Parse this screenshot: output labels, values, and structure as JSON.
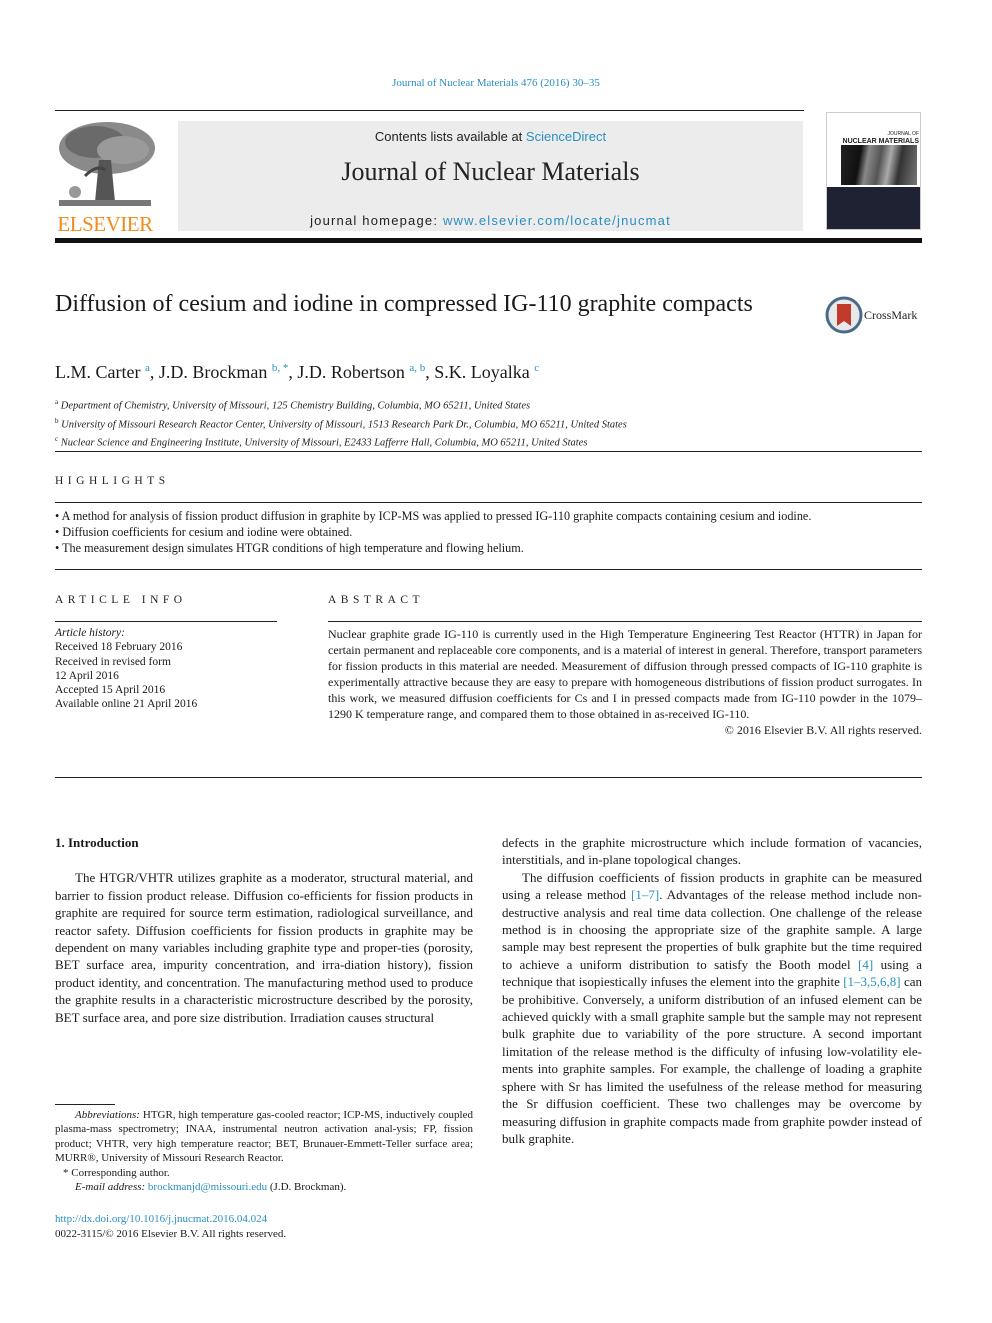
{
  "header": {
    "citation": "Journal of Nuclear Materials 476 (2016) 30–35",
    "contents_prefix": "Contents lists available at ",
    "contents_link": "ScienceDirect",
    "journal_title": "Journal of Nuclear Materials",
    "homepage_prefix": "journal homepage: ",
    "homepage_link": "www.elsevier.com/locate/jnucmat",
    "publisher_logo_text": "ELSEVIER",
    "cover_title_line1": "JOURNAL OF",
    "cover_title_line2": "NUCLEAR MATERIALS",
    "crossmark_label": "CrossMark"
  },
  "article": {
    "title": "Diffusion of cesium and iodine in compressed IG-110 graphite compacts",
    "authors": [
      {
        "name": "L.M. Carter",
        "sup": "a",
        "sep": ", "
      },
      {
        "name": "J.D. Brockman",
        "sup": "b, *",
        "sep": ", "
      },
      {
        "name": "J.D. Robertson",
        "sup": "a, b",
        "sep": ", "
      },
      {
        "name": "S.K. Loyalka",
        "sup": "c",
        "sep": ""
      }
    ],
    "affiliations": [
      {
        "key": "a",
        "text": "Department of Chemistry, University of Missouri, 125 Chemistry Building, Columbia, MO 65211, United States"
      },
      {
        "key": "b",
        "text": "University of Missouri Research Reactor Center, University of Missouri, 1513 Research Park Dr., Columbia, MO 65211, United States"
      },
      {
        "key": "c",
        "text": "Nuclear Science and Engineering Institute, University of Missouri, E2433 Lafferre Hall, Columbia, MO 65211, United States"
      }
    ]
  },
  "highlights": {
    "label": "HIGHLIGHTS",
    "items": [
      "A method for analysis of fission product diffusion in graphite by ICP-MS was applied to pressed IG-110 graphite compacts containing cesium and iodine.",
      "Diffusion coefficients for cesium and iodine were obtained.",
      "The measurement design simulates HTGR conditions of high temperature and flowing helium."
    ]
  },
  "article_info": {
    "label": "ARTICLE INFO",
    "history_label": "Article history:",
    "history": [
      "Received 18 February 2016",
      "Received in revised form",
      "12 April 2016",
      "Accepted 15 April 2016",
      "Available online 21 April 2016"
    ]
  },
  "abstract": {
    "label": "ABSTRACT",
    "text": "Nuclear graphite grade IG-110 is currently used in the High Temperature Engineering Test Reactor (HTTR) in Japan for certain permanent and replaceable core components, and is a material of interest in general. Therefore, transport parameters for fission products in this material are needed. Measurement of diffusion through pressed compacts of IG-110 graphite is experimentally attractive because they are easy to prepare with homogeneous distributions of fission product surrogates. In this work, we measured diffusion coefficients for Cs and I in pressed compacts made from IG-110 powder in the 1079–1290 K temperature range, and compared them to those obtained in as-received IG-110.",
    "copyright": "© 2016 Elsevier B.V. All rights reserved."
  },
  "introduction": {
    "heading": "1.  Introduction",
    "para1": "The HTGR/VHTR utilizes graphite as a moderator, structural material, and barrier to fission product release. Diffusion co-efficients for fission products in graphite are required for source term estimation, radiological surveillance, and reactor safety. Diffusion coefficients for fission products in graphite may be dependent on many variables including graphite type and proper-ties (porosity, BET surface area, impurity concentration, and irra-diation history), fission product identity, and concentration. The manufacturing method used to produce the graphite results in a characteristic microstructure described by the porosity, BET surface area, and pore size distribution. Irradiation causes structural defects in the graphite microstructure which include formation of vacancies, interstitials, and in-plane topological changes.",
    "para2_parts": [
      "The diffusion coefficients of fission products in graphite can be measured using a release method ",
      "[1–7]",
      ". Advantages of the release method include non-destructive analysis and real time data collection. One challenge of the release method is in choosing the appropriate size of the graphite sample. A large sample may best represent the properties of bulk graphite but the time required to achieve a uniform distribution to satisfy the Booth model ",
      "[4]",
      " using a technique that isopiestically infuses the element into the graphite ",
      "[1–3,5,6,8]",
      " can be prohibitive. Conversely, a uniform distribution of an infused element can be achieved quickly with a small graphite sample but the sample may not represent bulk graphite due to variability of the pore structure. A second important limitation of the release method is the difficulty of infusing low-volatility ele-ments into graphite samples. For example, the challenge of loading a graphite sphere with Sr has limited the usefulness of the release method for measuring the Sr diffusion coefficient. These two challenges may be overcome by measuring diffusion in graphite compacts made from graphite powder instead of bulk graphite."
    ],
    "left_col_text": "The HTGR/VHTR utilizes graphite as a moderator, structural material, and barrier to fission product release. Diffusion co-efficients for fission products in graphite are required for source term estimation, radiological surveillance, and reactor safety. Diffusion coefficients for fission products in graphite may be dependent on many variables including graphite type and proper-ties (porosity, BET surface area, impurity concentration, and irra-diation history), fission product identity, and concentration. The manufacturing method used to produce the graphite results in a characteristic microstructure described by the porosity, BET surface area, and pore size distribution. Irradiation causes structural",
    "right_col_continuation": "defects in the graphite microstructure which include formation of vacancies, interstitials, and in-plane topological changes."
  },
  "footnotes": {
    "abbrev_label": "Abbreviations:",
    "abbrev_text": " HTGR, high temperature gas-cooled reactor; ICP-MS, inductively coupled plasma-mass spectrometry; INAA, instrumental neutron activation anal-ysis; FP, fission product; VHTR, very high temperature reactor; BET, Brunauer-Emmett-Teller surface area; MURR®, University of Missouri Research Reactor.",
    "corresponding": "*  Corresponding author.",
    "email_label": "E-mail address:",
    "email": "brockmanjd@missouri.edu",
    "email_suffix": " (J.D. Brockman)."
  },
  "doi": {
    "link": "http://dx.doi.org/10.1016/j.jnucmat.2016.04.024",
    "issn_line": "0022-3115/© 2016 Elsevier B.V. All rights reserved."
  },
  "colors": {
    "link": "#2a8fc0",
    "elsevier_orange": "#f28a1e",
    "banner_gray": "#ececec"
  }
}
